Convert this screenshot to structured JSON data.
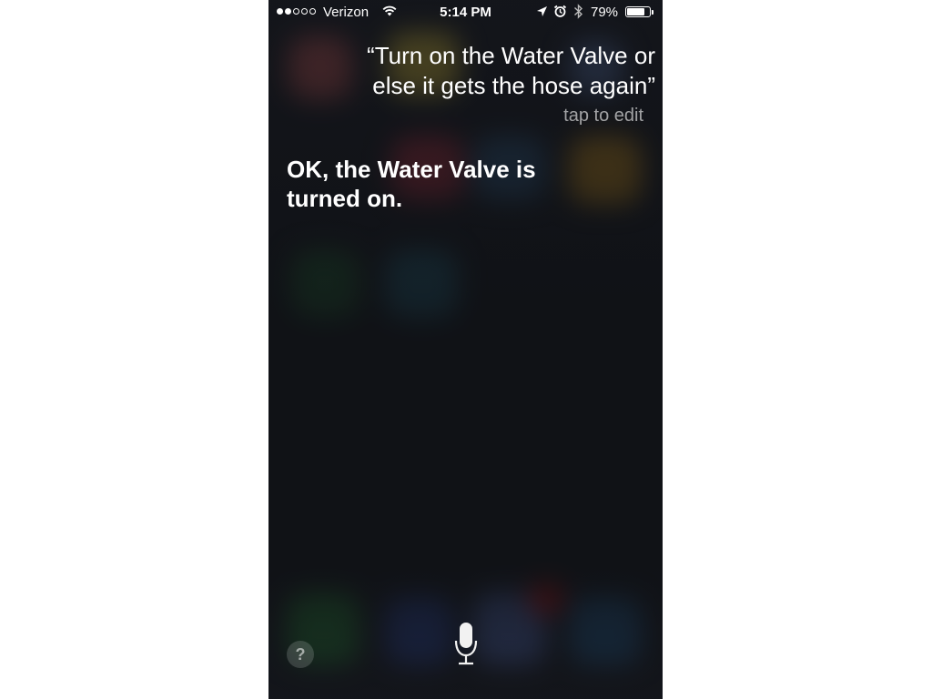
{
  "status_bar": {
    "signal_strength": 2,
    "signal_total": 5,
    "carrier": "Verizon",
    "wifi_icon": "wifi-icon",
    "time": "5:14 PM",
    "location_icon": "location-arrow-icon",
    "alarm_icon": "alarm-clock-icon",
    "bluetooth_icon": "bluetooth-icon",
    "battery_percent": "79%",
    "battery_level": 0.79
  },
  "siri": {
    "query_line1": "“Turn on the Water Valve or",
    "query_line2": "else it gets the hose again”",
    "edit_hint": "tap to edit",
    "response_line1": "OK, the Water Valve is",
    "response_line2": "turned on."
  },
  "controls": {
    "help_label": "?",
    "mic_icon": "microphone-icon"
  },
  "colors": {
    "background": "#15171c",
    "text": "#ffffff",
    "hint_text": "#a6a7aa"
  }
}
